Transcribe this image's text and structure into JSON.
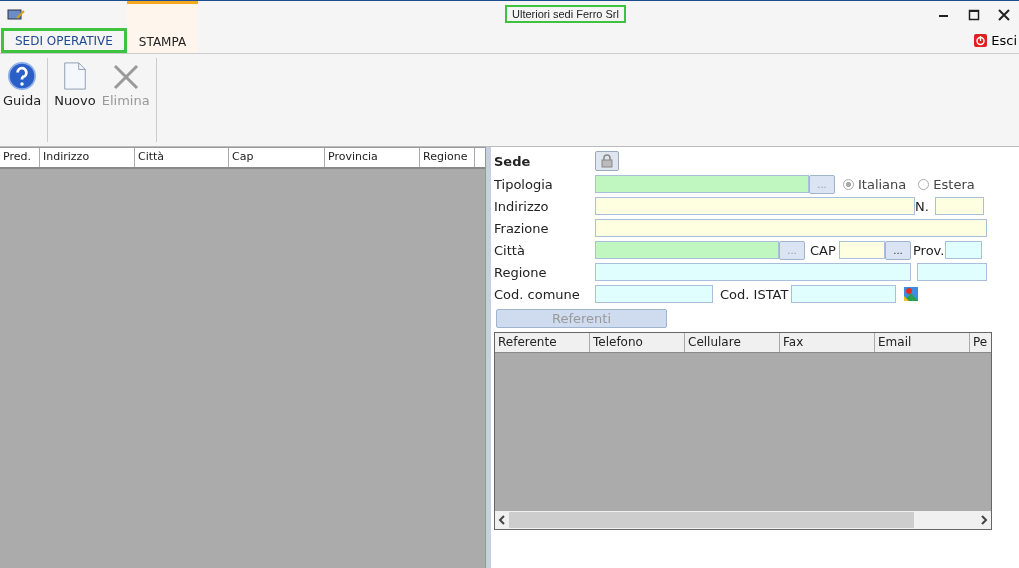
{
  "window": {
    "title": "Ulteriori sedi Ferro Srl"
  },
  "tabs": [
    {
      "label": "SEDI OPERATIVE",
      "selected": true
    },
    {
      "label": "STAMPA",
      "selected": false
    }
  ],
  "exit": {
    "label": "Esci"
  },
  "toolbar": [
    {
      "label": "Guida",
      "kind": "help",
      "disabled": false
    },
    {
      "label": "Nuovo",
      "kind": "new",
      "disabled": false
    },
    {
      "label": "Elimina",
      "kind": "delete",
      "disabled": true
    }
  ],
  "table": {
    "columns": [
      "Pred.",
      "Indirizzo",
      "Città",
      "Cap",
      "Provincia",
      "Regione"
    ]
  },
  "form": {
    "title": "Sede",
    "tipologia": {
      "label": "Tipologia",
      "color": "#c0f7c0",
      "button": "...",
      "options": [
        {
          "label": "Italiana",
          "selected": true
        },
        {
          "label": "Estera",
          "selected": false
        }
      ]
    },
    "indirizzo": {
      "label": "Indirizzo",
      "color": "#fefee0",
      "number_label": "N.",
      "number_field": {
        "color": "#fefee0"
      }
    },
    "frazione": {
      "label": "Frazione",
      "color": "#fefee0"
    },
    "citta": {
      "label": "Città",
      "color": "#c0f7c0",
      "button": "...",
      "cap_label": "CAP",
      "cap_field": {
        "color": "#fefee0"
      },
      "cap_button": "...",
      "prov_label": "Prov.",
      "prov_field": {
        "color": "#e0fefe"
      }
    },
    "regione": {
      "label": "Regione",
      "color": "#e0fefe",
      "extra_field": {
        "color": "#e0fefe"
      }
    },
    "codici": {
      "label": "Cod. comune",
      "color": "#e0fefe",
      "istat_label": "Cod. ISTAT",
      "istat_field": {
        "color": "#e0fefe"
      }
    },
    "referenti_button": {
      "label": "Referenti",
      "disabled": true
    }
  },
  "contacts": {
    "columns": [
      "Referente",
      "Telefono",
      "Cellulare",
      "Fax",
      "Email",
      "Pe"
    ]
  }
}
